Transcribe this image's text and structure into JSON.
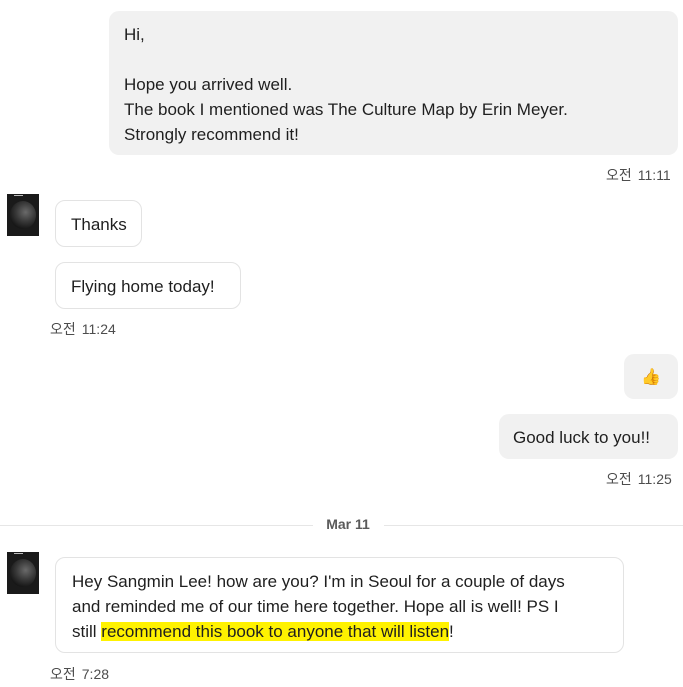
{
  "messages": {
    "m1": {
      "line1": "Hi,",
      "line2": "Hope you arrived well.",
      "line3": "The book I mentioned was The Culture Map by Erin Meyer.",
      "line4": "Strongly recommend it!",
      "ampm": "오전",
      "time": "11:11"
    },
    "m2": {
      "text": "Thanks"
    },
    "m3": {
      "text": "Flying home today!",
      "ampm": "오전",
      "time": "11:24"
    },
    "m4": {
      "emoji": "👍"
    },
    "m5": {
      "text": "Good luck to you!!",
      "ampm": "오전",
      "time": "11:25"
    },
    "m6": {
      "line1": "Hey Sangmin Lee! how are you? I'm in Seoul for a couple of days",
      "line2": "and reminded me of our time here together. Hope all is well! PS I",
      "line3_prefix": "still ",
      "line3_highlight": "recommend this book to anyone that will listen",
      "line3_suffix": "!",
      "ampm": "오전",
      "time": "7:28"
    }
  },
  "date_divider": "Mar 11",
  "colors": {
    "outgoing_bubble": "#f1f1f1",
    "incoming_border": "#e3e3e3",
    "highlight": "#fff200"
  },
  "icons": {
    "avatar": "contact-avatar",
    "reaction": "thumbs-up-icon"
  }
}
